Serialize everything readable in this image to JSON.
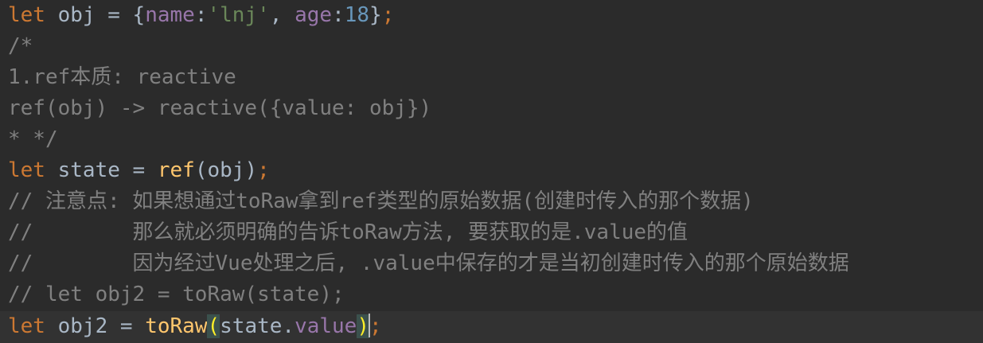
{
  "editor": {
    "lines": [
      {
        "tokens": [
          "let",
          " ",
          "obj",
          " = {",
          "name",
          ":",
          "'lnj'",
          ", ",
          "age",
          ":",
          "18",
          "}",
          ";"
        ]
      },
      {
        "tokens": [
          "/*"
        ]
      },
      {
        "tokens": [
          "1.ref本质: reactive"
        ]
      },
      {
        "tokens": [
          "ref(obj) -> reactive({value: obj})"
        ]
      },
      {
        "tokens": [
          "* */"
        ]
      },
      {
        "tokens": [
          "let",
          " state = ",
          "ref",
          "(obj)",
          ";"
        ]
      },
      {
        "tokens": [
          "// 注意点: 如果想通过toRaw拿到ref类型的原始数据(创建时传入的那个数据)"
        ]
      },
      {
        "tokens": [
          "//        那么就必须明确的告诉toRaw方法, 要获取的是.value的值"
        ]
      },
      {
        "tokens": [
          "//        因为经过Vue处理之后, .value中保存的才是当初创建时传入的那个原始数据"
        ]
      },
      {
        "tokens": [
          "// let obj2 = toRaw(state);"
        ]
      },
      {
        "tokens": [
          "let",
          " obj2 = ",
          "toRaw",
          "(",
          "state.",
          "value",
          ")",
          ";"
        ]
      }
    ]
  }
}
